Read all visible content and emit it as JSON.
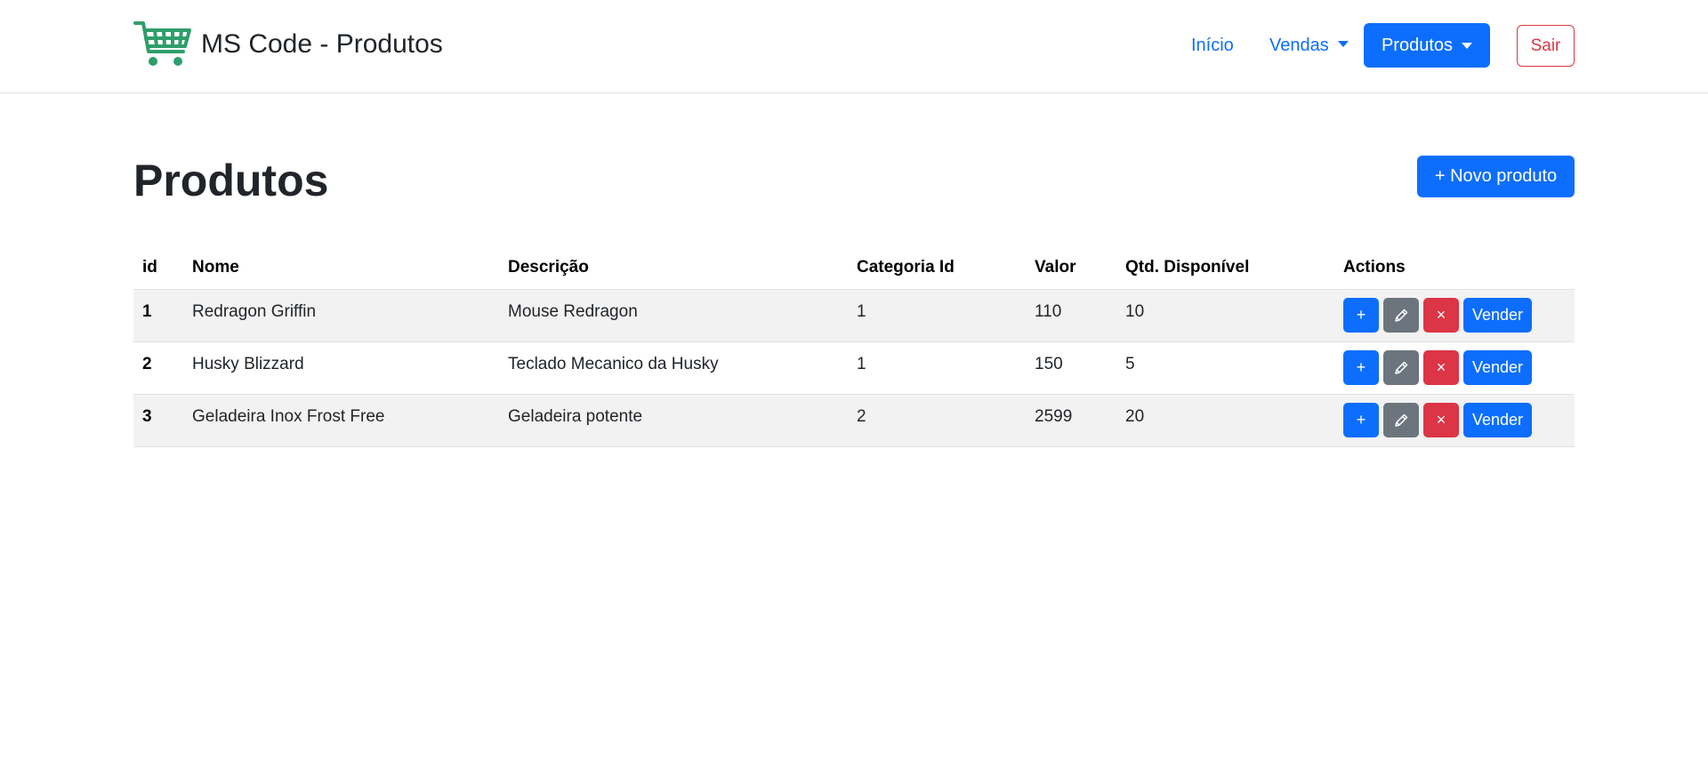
{
  "navbar": {
    "brand_text": "MS Code - Produtos",
    "brand_icon": "shopping-cart-icon",
    "brand_color": "#2e9e6b",
    "links": {
      "inicio": "Início",
      "vendas": "Vendas",
      "produtos": "Produtos",
      "sair": "Sair"
    }
  },
  "page": {
    "title": "Produtos",
    "new_button": "+ Novo produto"
  },
  "table": {
    "headers": {
      "id": "id",
      "nome": "Nome",
      "descricao": "Descrição",
      "categoria": "Categoria Id",
      "valor": "Valor",
      "qtd": "Qtd. Disponível",
      "actions": "Actions"
    },
    "rows": [
      {
        "id": "1",
        "nome": "Redragon Griffin",
        "descricao": "Mouse Redragon",
        "categoria": "1",
        "valor": "110",
        "qtd": "10"
      },
      {
        "id": "2",
        "nome": "Husky Blizzard",
        "descricao": "Teclado Mecanico da Husky",
        "categoria": "1",
        "valor": "150",
        "qtd": "5"
      },
      {
        "id": "3",
        "nome": "Geladeira Inox Frost Free",
        "descricao": "Geladeira potente",
        "categoria": "2",
        "valor": "2599",
        "qtd": "20"
      }
    ],
    "row_actions": {
      "add": "+",
      "edit_icon": "pencil-icon",
      "delete": "×",
      "sell": "Vender"
    }
  },
  "colors": {
    "primary": "#0d6efd",
    "secondary": "#6c757d",
    "danger": "#dc3545",
    "stripe": "#f2f2f2"
  }
}
